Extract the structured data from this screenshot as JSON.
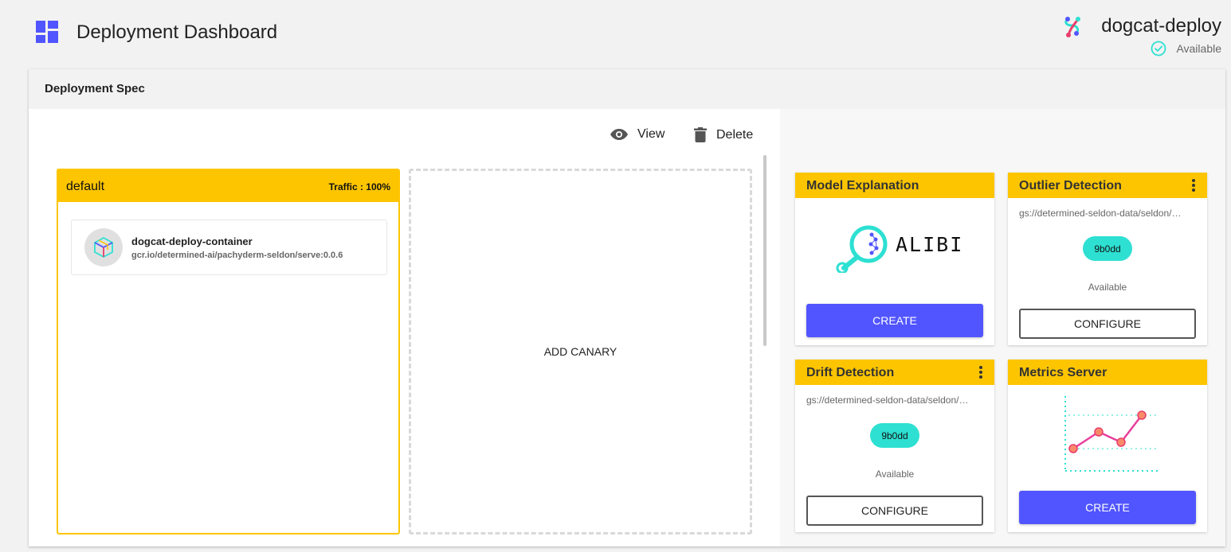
{
  "header": {
    "title": "Deployment Dashboard",
    "deployment_name": "dogcat-deploy",
    "status": "Available"
  },
  "panel": {
    "title": "Deployment Spec",
    "view_label": "View",
    "delete_label": "Delete"
  },
  "predictor": {
    "name": "default",
    "traffic": "Traffic : 100%",
    "container": {
      "name": "dogcat-deploy-container",
      "image": "gcr.io/determined-ai/pachyderm-seldon/serve:0.0.6"
    }
  },
  "canary": {
    "label": "ADD CANARY"
  },
  "components": {
    "model_explanation": {
      "title": "Model Explanation",
      "logo_text": "ALIBI",
      "button": "CREATE"
    },
    "outlier_detection": {
      "title": "Outlier Detection",
      "path": "gs://determined-seldon-data/seldon/…",
      "hash": "9b0dd",
      "status": "Available",
      "button": "CONFIGURE"
    },
    "drift_detection": {
      "title": "Drift Detection",
      "path": "gs://determined-seldon-data/seldon/…",
      "hash": "9b0dd",
      "status": "Available",
      "button": "CONFIGURE"
    },
    "metrics_server": {
      "title": "Metrics Server",
      "button": "CREATE"
    }
  },
  "colors": {
    "accent_yellow": "#fdc500",
    "primary_button": "#5155ff",
    "teal": "#2de0d2",
    "dashboard_icon": "#5155ff"
  },
  "icons": [
    "dashboard-icon",
    "seldon-logo-icon",
    "check-circle-icon",
    "eye-icon",
    "trash-icon",
    "cube-icon",
    "alibi-logo-icon",
    "kebab-menu-icon",
    "metrics-chart-icon"
  ]
}
